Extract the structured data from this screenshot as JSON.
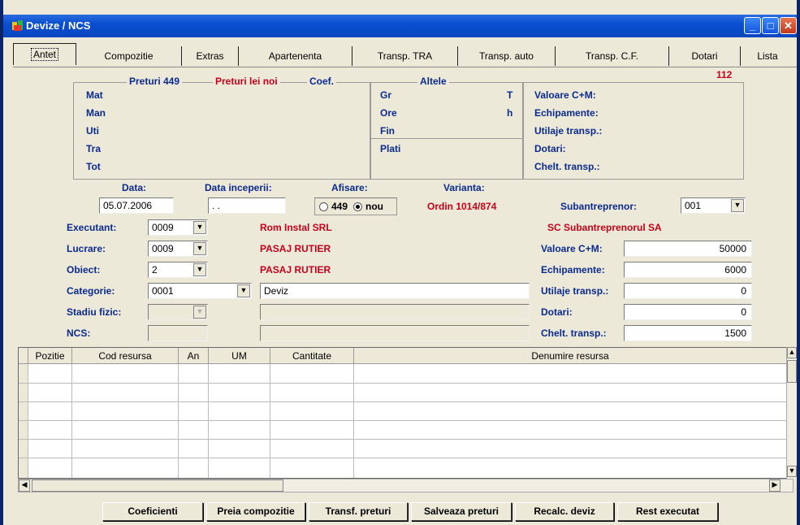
{
  "window": {
    "title": "Devize / NCS"
  },
  "tabs": [
    "Antet",
    "Compozitie",
    "Extras",
    "Apartenenta",
    "Transp. TRA",
    "Transp. auto",
    "Transp. C.F.",
    "Dotari",
    "Lista"
  ],
  "summary": {
    "count": "112",
    "group_preturi449": "Preturi 449",
    "group_preturi_lei_noi": "Preturi lei noi",
    "group_coef": "Coef.",
    "group_altele": "Altele",
    "rows": [
      "Mat",
      "Man",
      "Uti",
      "Tra",
      "Tot"
    ],
    "altele_rows": [
      "Gr",
      "Ore",
      "Fin",
      "Plati"
    ],
    "altele_units": [
      "T",
      "h"
    ],
    "right_rows": [
      "Valoare C+M:",
      "Echipamente:",
      "Utilaje transp.:",
      "Dotari:",
      "Chelt. transp.:"
    ]
  },
  "form": {
    "data_label": "Data:",
    "data_value": "05.07.2006",
    "data_inceperii_label": "Data inceperii:",
    "data_inceperii_value": ". .",
    "afisare_label": "Afisare:",
    "afisare_opt1": "449",
    "afisare_opt2": "nou",
    "varianta_label": "Varianta:",
    "varianta_value": "Ordin 1014/874",
    "subantreprenor_label": "Subantreprenor:",
    "subantreprenor_value": "001",
    "subantreprenor_name": "SC Subantreprenorul SA",
    "executant_label": "Executant:",
    "executant_value": "0009",
    "executant_name": "Rom Instal SRL",
    "lucrare_label": "Lucrare:",
    "lucrare_value": "0009",
    "lucrare_name": "PASAJ RUTIER",
    "obiect_label": "Obiect:",
    "obiect_value": "2",
    "obiect_name": "PASAJ RUTIER",
    "categorie_label": "Categorie:",
    "categorie_value": "0001",
    "categorie_name": "Deviz",
    "stadiu_label": "Stadiu fizic:",
    "ncs_label": "NCS:",
    "valoare_cm_label": "Valoare C+M:",
    "valoare_cm_value": "50000",
    "echipamente_label": "Echipamente:",
    "echipamente_value": "6000",
    "utilaje_label": "Utilaje transp.:",
    "utilaje_value": "0",
    "dotari_label": "Dotari:",
    "dotari_value": "0",
    "chelt_label": "Chelt. transp.:",
    "chelt_value": "1500"
  },
  "grid": {
    "columns": [
      "Pozitie",
      "Cod resursa",
      "An",
      "UM",
      "Cantitate",
      "Denumire resursa"
    ]
  },
  "buttons": [
    "Coeficienti",
    "Preia compozitie",
    "Transf. preturi",
    "Salveaza preturi",
    "Recalc. deviz",
    "Rest executat"
  ],
  "colors": {
    "label_blue": "#0b2a8f",
    "accent_red": "#c8001a",
    "title_blue": "#0a4fd0"
  }
}
